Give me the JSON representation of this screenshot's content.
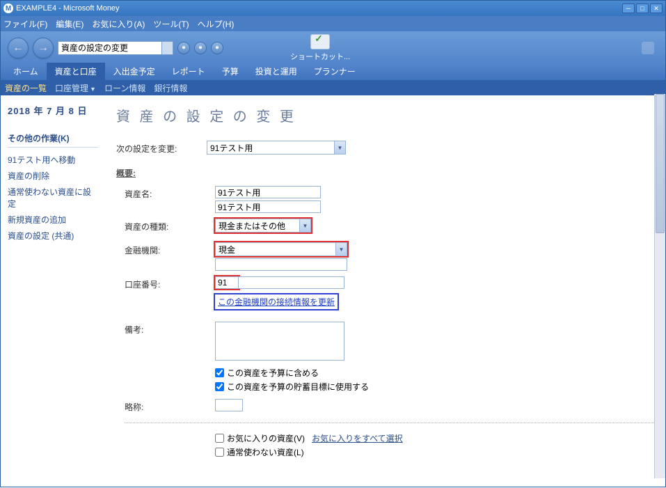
{
  "window": {
    "title": "EXAMPLE4 - Microsoft Money"
  },
  "menubar": {
    "file": "ファイル(F)",
    "edit": "編集(E)",
    "favorites": "お気に入り(A)",
    "tools": "ツール(T)",
    "help": "ヘルプ(H)"
  },
  "toolbar": {
    "address": "資産の設定の変更",
    "shortcut": "ショートカット..."
  },
  "ptabs": {
    "home": "ホーム",
    "assets": "資産と口座",
    "deposits": "入出金予定",
    "reports": "レポート",
    "budget": "予算",
    "invest": "投資と運用",
    "planner": "プランナー"
  },
  "stabs": {
    "asset_list": "資産の一覧",
    "account_mgmt": "口座管理",
    "loan_info": "ローン情報",
    "bank_info": "銀行情報"
  },
  "sidebar": {
    "date": "2018 年 7 月 8 日",
    "other_ops": "その他の作業(K)",
    "items": [
      "91テスト用へ移動",
      "資産の削除",
      "通常使わない資産に設定",
      "新規資産の追加",
      "資産の設定 (共通)"
    ]
  },
  "main": {
    "title": "資 産 の 設 定 の 変 更",
    "row_change": "次の設定を変更:",
    "target_select": "91テスト用",
    "overview": "概要:",
    "labels": {
      "asset_name": "資産名:",
      "asset_type": "資産の種類:",
      "institution": "金融機関:",
      "account_no": "口座番号:",
      "notes": "備考:",
      "abbrev": "略称:"
    },
    "fields": {
      "asset_name1": "91テスト用",
      "asset_name2": "91テスト用",
      "asset_type": "現金またはその他",
      "institution": "現金",
      "institution2": "",
      "account_no": "91",
      "notes": "",
      "abbrev": ""
    },
    "update_link": "この金融機関の接続情報を更新",
    "chk_budget": "この資産を予算に含める",
    "chk_savings": "この資産を予算の貯蓄目標に使用する",
    "chk_fav": "お気に入りの資産(V)",
    "fav_link": "お気に入りをすべて選択",
    "chk_unused": "通常使わない資産(L)"
  }
}
